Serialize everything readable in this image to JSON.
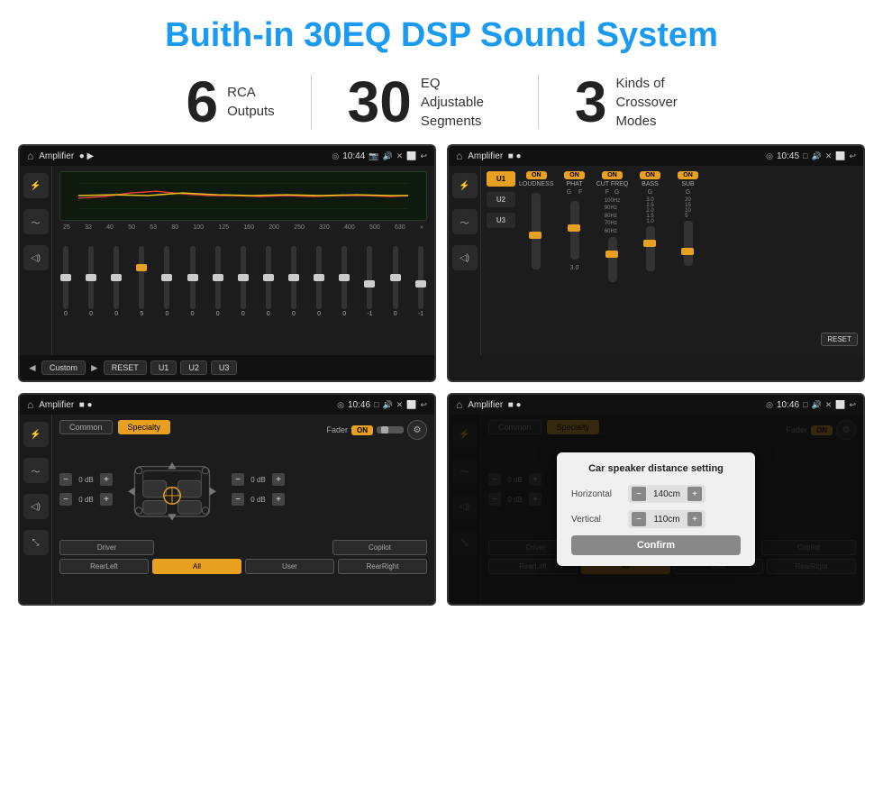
{
  "page": {
    "title": "Buith-in 30EQ DSP Sound System",
    "stats": [
      {
        "number": "6",
        "label": "RCA\nOutputs"
      },
      {
        "number": "30",
        "label": "EQ Adjustable\nSegments"
      },
      {
        "number": "3",
        "label": "Kinds of\nCrossover Modes"
      }
    ]
  },
  "screens": {
    "screen1": {
      "status": {
        "title": "Amplifier",
        "time": "10:44"
      },
      "eq_frequencies": [
        "25",
        "32",
        "40",
        "50",
        "63",
        "80",
        "100",
        "125",
        "160",
        "200",
        "250",
        "320",
        "400",
        "500",
        "630"
      ],
      "eq_values": [
        "0",
        "0",
        "0",
        "5",
        "0",
        "0",
        "0",
        "0",
        "0",
        "0",
        "0",
        "0",
        "-1",
        "0",
        "-1"
      ],
      "buttons": [
        "Custom",
        "RESET",
        "U1",
        "U2",
        "U3"
      ]
    },
    "screen2": {
      "status": {
        "title": "Amplifier",
        "time": "10:45"
      },
      "presets": [
        "U1",
        "U2",
        "U3"
      ],
      "controls": [
        "LOUDNESS",
        "PHAT",
        "CUT FREQ",
        "BASS",
        "SUB"
      ],
      "reset_label": "RESET"
    },
    "screen3": {
      "status": {
        "title": "Amplifier",
        "time": "10:46"
      },
      "tabs": [
        "Common",
        "Specialty"
      ],
      "fader_label": "Fader",
      "db_values": [
        "0 dB",
        "0 dB",
        "0 dB",
        "0 dB"
      ],
      "footer_btns": [
        "Driver",
        "",
        "Copilot",
        "RearLeft",
        "All",
        "User",
        "RearRight"
      ]
    },
    "screen4": {
      "status": {
        "title": "Amplifier",
        "time": "10:46"
      },
      "dialog": {
        "title": "Car speaker distance setting",
        "horizontal_label": "Horizontal",
        "horizontal_value": "140cm",
        "vertical_label": "Vertical",
        "vertical_value": "110cm",
        "confirm_label": "Confirm"
      },
      "footer_btns": [
        "Driver",
        "",
        "Copilot",
        "RearLeft",
        "All",
        "User",
        "RearRight"
      ]
    }
  },
  "colors": {
    "accent": "#e8a020",
    "title_blue": "#1a9af0",
    "screen_bg": "#1c1c1c",
    "status_bg": "#111111"
  }
}
